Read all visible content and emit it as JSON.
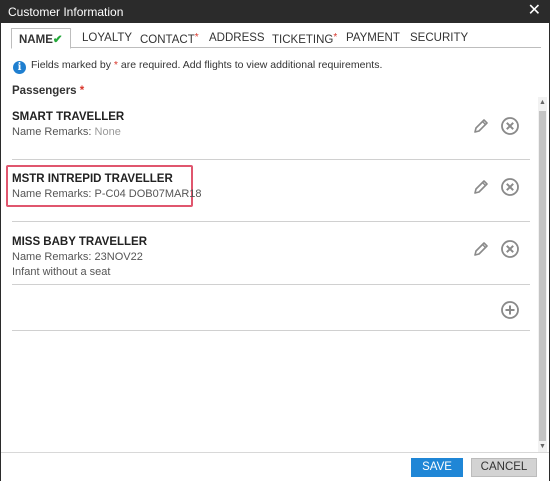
{
  "window": {
    "title": "Customer Information",
    "close_glyph": "✕"
  },
  "tabs": [
    {
      "label": "NAME",
      "active": true,
      "suffix": "✔"
    },
    {
      "label": "LOYALTY"
    },
    {
      "label": "CONTACT",
      "required": "*"
    },
    {
      "label": "ADDRESS"
    },
    {
      "label": "TICKETING",
      "required": "*"
    },
    {
      "label": "PAYMENT"
    },
    {
      "label": "SECURITY"
    }
  ],
  "info": {
    "icon": "info-icon",
    "text_before": "Fields marked by ",
    "star": "*",
    "text_after": " are required. Add flights to view additional requirements."
  },
  "passengers_section": {
    "title": "Passengers",
    "star": "*"
  },
  "passengers": [
    {
      "name": "SMART TRAVELLER",
      "remarks_label": "Name Remarks: ",
      "remarks_value": "None",
      "extra": ""
    },
    {
      "name": "MSTR INTREPID TRAVELLER",
      "remarks_label": "Name Remarks: ",
      "remarks_value": "P-C04 DOB07MAR18",
      "extra": ""
    },
    {
      "name": "MISS BABY TRAVELLER",
      "remarks_label": "Name Remarks: ",
      "remarks_value": "23NOV22",
      "extra": "Infant without a seat"
    }
  ],
  "actions": {
    "edit_icon": "pencil-icon",
    "remove_icon": "remove-circle-icon",
    "add_icon": "add-circle-icon"
  },
  "footer": {
    "save_label": "SAVE",
    "cancel_label": "CANCEL"
  },
  "colors": {
    "accent": "#1f86d6",
    "required": "#d9362b",
    "check": "#23a83a",
    "highlight": "#e0566e"
  }
}
